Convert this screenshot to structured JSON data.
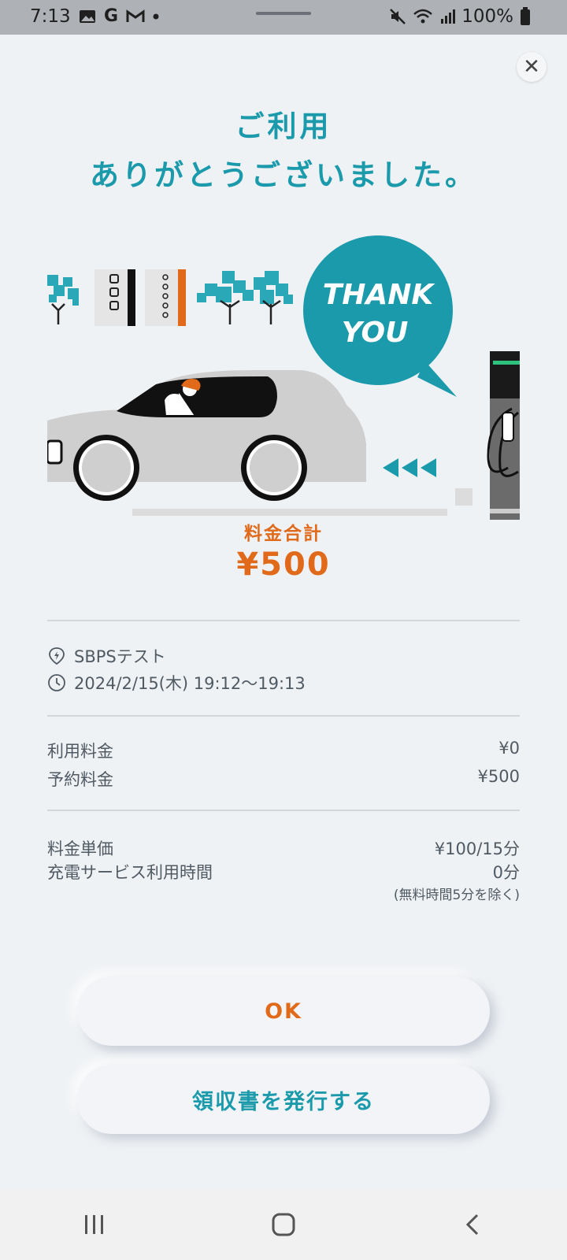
{
  "status_bar": {
    "time": "7:13",
    "battery": "100%",
    "icons": [
      "gallery-icon",
      "google-icon",
      "gmail-icon",
      "dot-icon",
      "mute-icon",
      "wifi-icon",
      "signal-icon",
      "battery-icon"
    ]
  },
  "dialog": {
    "close_label": "✕",
    "title_line1": "ご利用",
    "title_line2": "ありがとうございました。",
    "illustration_text_line1": "THANK",
    "illustration_text_line2": "YOU",
    "total_label": "料金合計",
    "total_value": "¥500",
    "station_name": "SBPSテスト",
    "datetime": "2024/2/15(木) 19:12～19:13",
    "fees": [
      {
        "label": "利用料金",
        "value": "¥0"
      },
      {
        "label": "予約料金",
        "value": "¥500"
      }
    ],
    "details": [
      {
        "label": "料金単価",
        "value": "¥100/15分"
      },
      {
        "label": "充電サービス利用時間",
        "value": "0分"
      }
    ],
    "details_note": "(無料時間5分を除く)",
    "ok_button": "OK",
    "receipt_button": "領収書を発行する"
  },
  "colors": {
    "accent_teal": "#1a9aaa",
    "accent_orange": "#e06a1a",
    "background": "#eff2f5"
  }
}
